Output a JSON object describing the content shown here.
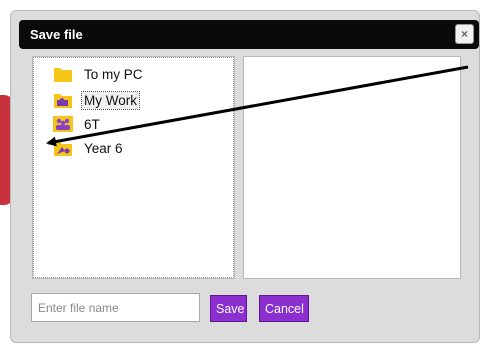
{
  "dialog": {
    "title": "Save file",
    "close_label": "×"
  },
  "tree": {
    "items": [
      {
        "label": "To my PC",
        "icon": "folder-icon"
      },
      {
        "label": "My Work",
        "icon": "my-work-folder-icon",
        "selected": true
      },
      {
        "label": "6T",
        "icon": "class-group-icon"
      },
      {
        "label": "Year 6",
        "icon": "shared-folder-icon"
      }
    ]
  },
  "filename": {
    "placeholder": "Enter file name",
    "value": ""
  },
  "buttons": {
    "save_label": "Save",
    "cancel_label": "Cancel"
  },
  "colors": {
    "titlebar": "#0a0a0a",
    "button": "#8c2fd0",
    "folder": "#f5c518",
    "dialog_bg": "#dcdcdc"
  }
}
